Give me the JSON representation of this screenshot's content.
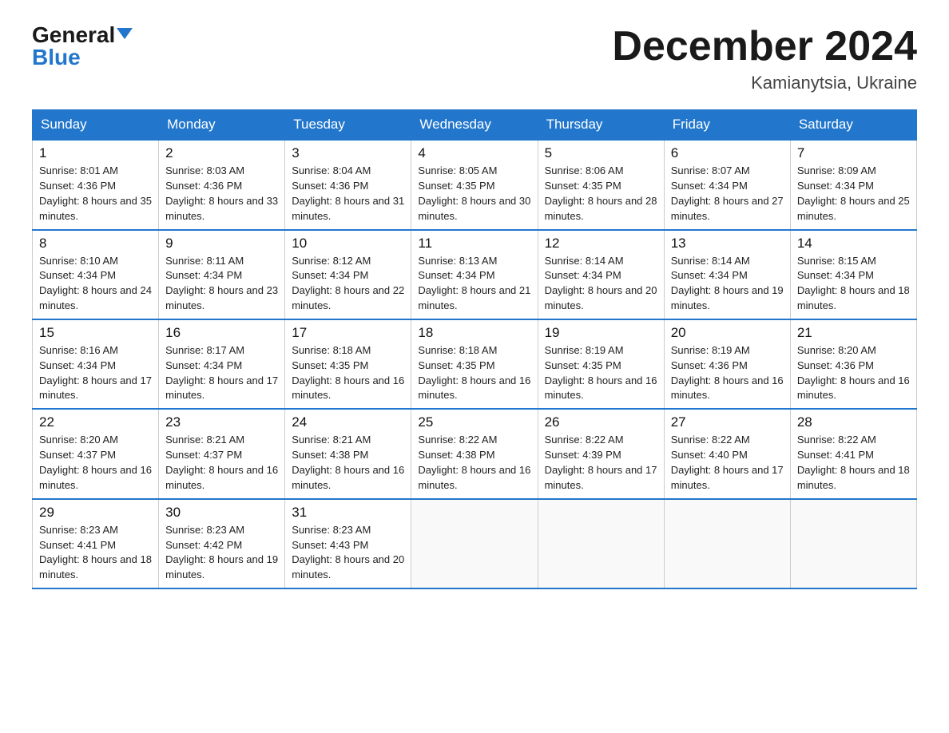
{
  "header": {
    "logo_general": "General",
    "logo_blue": "Blue",
    "month_title": "December 2024",
    "location": "Kamianytsia, Ukraine"
  },
  "weekdays": [
    "Sunday",
    "Monday",
    "Tuesday",
    "Wednesday",
    "Thursday",
    "Friday",
    "Saturday"
  ],
  "weeks": [
    [
      {
        "day": 1,
        "sunrise": "8:01 AM",
        "sunset": "4:36 PM",
        "daylight": "8 hours and 35 minutes."
      },
      {
        "day": 2,
        "sunrise": "8:03 AM",
        "sunset": "4:36 PM",
        "daylight": "8 hours and 33 minutes."
      },
      {
        "day": 3,
        "sunrise": "8:04 AM",
        "sunset": "4:36 PM",
        "daylight": "8 hours and 31 minutes."
      },
      {
        "day": 4,
        "sunrise": "8:05 AM",
        "sunset": "4:35 PM",
        "daylight": "8 hours and 30 minutes."
      },
      {
        "day": 5,
        "sunrise": "8:06 AM",
        "sunset": "4:35 PM",
        "daylight": "8 hours and 28 minutes."
      },
      {
        "day": 6,
        "sunrise": "8:07 AM",
        "sunset": "4:34 PM",
        "daylight": "8 hours and 27 minutes."
      },
      {
        "day": 7,
        "sunrise": "8:09 AM",
        "sunset": "4:34 PM",
        "daylight": "8 hours and 25 minutes."
      }
    ],
    [
      {
        "day": 8,
        "sunrise": "8:10 AM",
        "sunset": "4:34 PM",
        "daylight": "8 hours and 24 minutes."
      },
      {
        "day": 9,
        "sunrise": "8:11 AM",
        "sunset": "4:34 PM",
        "daylight": "8 hours and 23 minutes."
      },
      {
        "day": 10,
        "sunrise": "8:12 AM",
        "sunset": "4:34 PM",
        "daylight": "8 hours and 22 minutes."
      },
      {
        "day": 11,
        "sunrise": "8:13 AM",
        "sunset": "4:34 PM",
        "daylight": "8 hours and 21 minutes."
      },
      {
        "day": 12,
        "sunrise": "8:14 AM",
        "sunset": "4:34 PM",
        "daylight": "8 hours and 20 minutes."
      },
      {
        "day": 13,
        "sunrise": "8:14 AM",
        "sunset": "4:34 PM",
        "daylight": "8 hours and 19 minutes."
      },
      {
        "day": 14,
        "sunrise": "8:15 AM",
        "sunset": "4:34 PM",
        "daylight": "8 hours and 18 minutes."
      }
    ],
    [
      {
        "day": 15,
        "sunrise": "8:16 AM",
        "sunset": "4:34 PM",
        "daylight": "8 hours and 17 minutes."
      },
      {
        "day": 16,
        "sunrise": "8:17 AM",
        "sunset": "4:34 PM",
        "daylight": "8 hours and 17 minutes."
      },
      {
        "day": 17,
        "sunrise": "8:18 AM",
        "sunset": "4:35 PM",
        "daylight": "8 hours and 16 minutes."
      },
      {
        "day": 18,
        "sunrise": "8:18 AM",
        "sunset": "4:35 PM",
        "daylight": "8 hours and 16 minutes."
      },
      {
        "day": 19,
        "sunrise": "8:19 AM",
        "sunset": "4:35 PM",
        "daylight": "8 hours and 16 minutes."
      },
      {
        "day": 20,
        "sunrise": "8:19 AM",
        "sunset": "4:36 PM",
        "daylight": "8 hours and 16 minutes."
      },
      {
        "day": 21,
        "sunrise": "8:20 AM",
        "sunset": "4:36 PM",
        "daylight": "8 hours and 16 minutes."
      }
    ],
    [
      {
        "day": 22,
        "sunrise": "8:20 AM",
        "sunset": "4:37 PM",
        "daylight": "8 hours and 16 minutes."
      },
      {
        "day": 23,
        "sunrise": "8:21 AM",
        "sunset": "4:37 PM",
        "daylight": "8 hours and 16 minutes."
      },
      {
        "day": 24,
        "sunrise": "8:21 AM",
        "sunset": "4:38 PM",
        "daylight": "8 hours and 16 minutes."
      },
      {
        "day": 25,
        "sunrise": "8:22 AM",
        "sunset": "4:38 PM",
        "daylight": "8 hours and 16 minutes."
      },
      {
        "day": 26,
        "sunrise": "8:22 AM",
        "sunset": "4:39 PM",
        "daylight": "8 hours and 17 minutes."
      },
      {
        "day": 27,
        "sunrise": "8:22 AM",
        "sunset": "4:40 PM",
        "daylight": "8 hours and 17 minutes."
      },
      {
        "day": 28,
        "sunrise": "8:22 AM",
        "sunset": "4:41 PM",
        "daylight": "8 hours and 18 minutes."
      }
    ],
    [
      {
        "day": 29,
        "sunrise": "8:23 AM",
        "sunset": "4:41 PM",
        "daylight": "8 hours and 18 minutes."
      },
      {
        "day": 30,
        "sunrise": "8:23 AM",
        "sunset": "4:42 PM",
        "daylight": "8 hours and 19 minutes."
      },
      {
        "day": 31,
        "sunrise": "8:23 AM",
        "sunset": "4:43 PM",
        "daylight": "8 hours and 20 minutes."
      },
      null,
      null,
      null,
      null
    ]
  ]
}
